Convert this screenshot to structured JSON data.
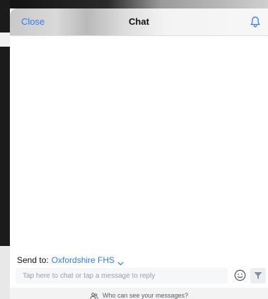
{
  "header": {
    "close_label": "Close",
    "title": "Chat",
    "bell_icon": "bell-icon"
  },
  "composer": {
    "send_to_label": "Send to:",
    "recipient": "Oxfordshire FHS",
    "placeholder": "Tap here to chat or tap a message to reply",
    "emoji_icon": "emoji-icon",
    "send_icon": "send-icon"
  },
  "footer": {
    "who_can_see": "Who can see your messages?",
    "who_icon": "people-icon"
  },
  "colors": {
    "accent": "#2f7cf6",
    "header_bg": "#f7f7f7",
    "footer_bg": "#f3f3f3"
  }
}
